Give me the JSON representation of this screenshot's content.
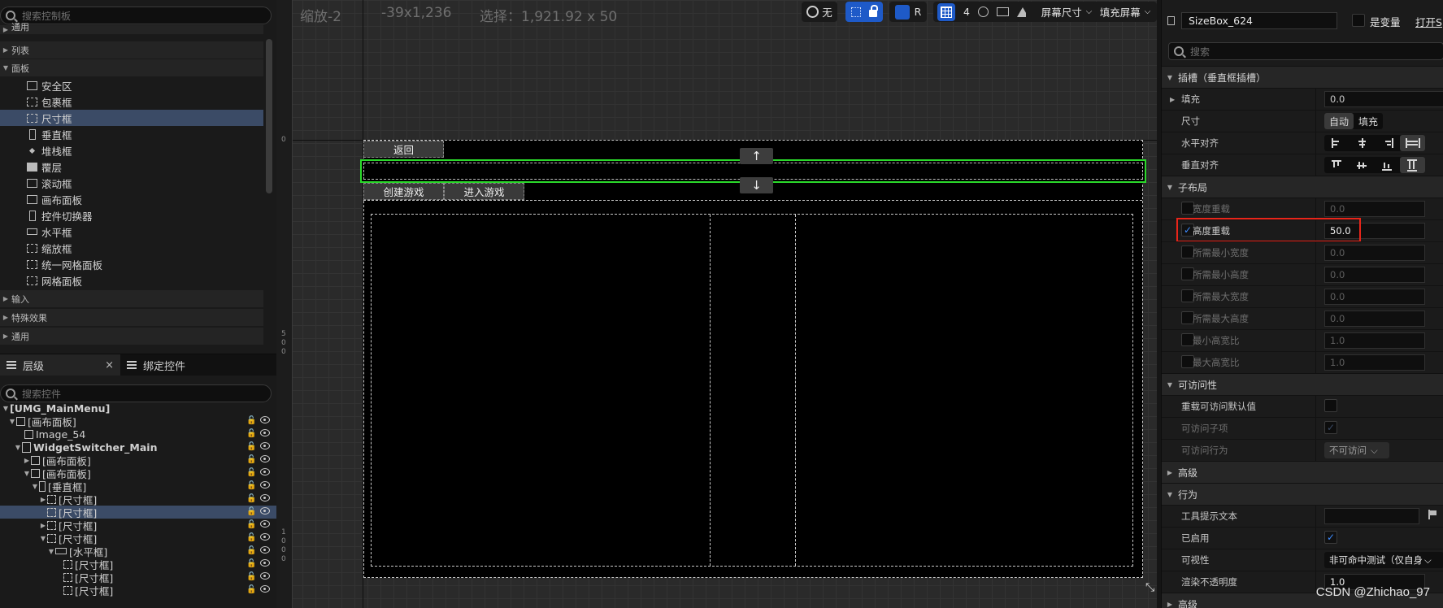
{
  "palette": {
    "search_placeholder": "搜索控制板",
    "categories": [
      "通用",
      "列表",
      "面板",
      "输入",
      "特殊效果",
      "通用"
    ],
    "panel_items": [
      "安全区",
      "包裹框",
      "尺寸框",
      "垂直框",
      "堆栈框",
      "覆层",
      "滚动框",
      "画布面板",
      "控件切换器",
      "水平框",
      "缩放框",
      "统一网格面板",
      "网格面板"
    ],
    "selected_item": "尺寸框"
  },
  "hierarchy": {
    "tab_layers": "层级",
    "tab_bindings": "绑定控件",
    "close_glyph": "×",
    "search_placeholder": "搜索控件",
    "rows": [
      {
        "label": "[UMG_MainMenu]"
      },
      {
        "label": "[画布面板]"
      },
      {
        "label": "Image_54"
      },
      {
        "label": "WidgetSwitcher_Main"
      },
      {
        "label": "[画布面板]"
      },
      {
        "label": "[画布面板]"
      },
      {
        "label": "[垂直框]"
      },
      {
        "label": "[尺寸框]"
      },
      {
        "label": "[尺寸框]"
      },
      {
        "label": "[尺寸框]"
      },
      {
        "label": "[尺寸框]"
      },
      {
        "label": "[水平框]"
      },
      {
        "label": "[尺寸框]"
      },
      {
        "label": "[尺寸框]"
      },
      {
        "label": "[尺寸框]"
      }
    ]
  },
  "designer": {
    "zoom_text": "缩放-2",
    "coords_text": "-39x1,236",
    "selection_text": "选择：1,921.92 x 50",
    "ruler_labels": [
      "0",
      "5",
      "0",
      "0",
      "1",
      "0",
      "0",
      "0"
    ],
    "toolbar": {
      "none_label": "无",
      "r_label": "R",
      "grid_count": "4",
      "screen_size": "屏幕尺寸",
      "fill_screen": "填充屏幕"
    },
    "buttons": {
      "back": "返回",
      "create_game": "创建游戏",
      "enter_game": "进入游戏",
      "up_arrow": "↑",
      "down_arrow": "↓"
    }
  },
  "details": {
    "widget_name": "SizeBox_624",
    "is_variable": "是变量",
    "open_link": "打开S",
    "search_placeholder": "搜索",
    "sections": {
      "slot": "插槽（垂直框插槽）",
      "child_layout": "子布局",
      "accessibility": "可访问性",
      "advanced": "高级",
      "behavior": "行为",
      "advanced2": "高级"
    },
    "props": {
      "padding": "填充",
      "padding_val": "0.0",
      "size": "尺寸",
      "size_auto": "自动",
      "size_fill": "填充",
      "h_align": "水平对齐",
      "v_align": "垂直对齐",
      "width_override": "宽度重载",
      "width_override_val": "0.0",
      "height_override": "高度重载",
      "height_override_val": "50.0",
      "min_desired_width": "所需最小宽度",
      "min_desired_width_val": "0.0",
      "min_desired_height": "所需最小高度",
      "min_desired_height_val": "0.0",
      "max_desired_width": "所需最大宽度",
      "max_desired_width_val": "0.0",
      "max_desired_height": "所需最大高度",
      "max_desired_height_val": "0.0",
      "min_aspect": "最小高宽比",
      "min_aspect_val": "1.0",
      "max_aspect": "最大高宽比",
      "max_aspect_val": "1.0",
      "override_access": "重载可访问默认值",
      "access_children": "可访问子项",
      "access_behavior": "可访问行为",
      "access_behavior_val": "不可访问",
      "tooltip_text": "工具提示文本",
      "enabled": "已启用",
      "visibility": "可视性",
      "visibility_val": "非可命中测试（仅自身",
      "render_opacity": "渲染不透明度",
      "render_opacity_val": "1.0"
    }
  },
  "watermark": "CSDN @Zhichao_97",
  "colors": {
    "selection_blue": "#3b4b66",
    "accent_green": "#2bd92b",
    "highlight_red": "#e8251a",
    "toolbar_blue": "#1e5ac8"
  }
}
